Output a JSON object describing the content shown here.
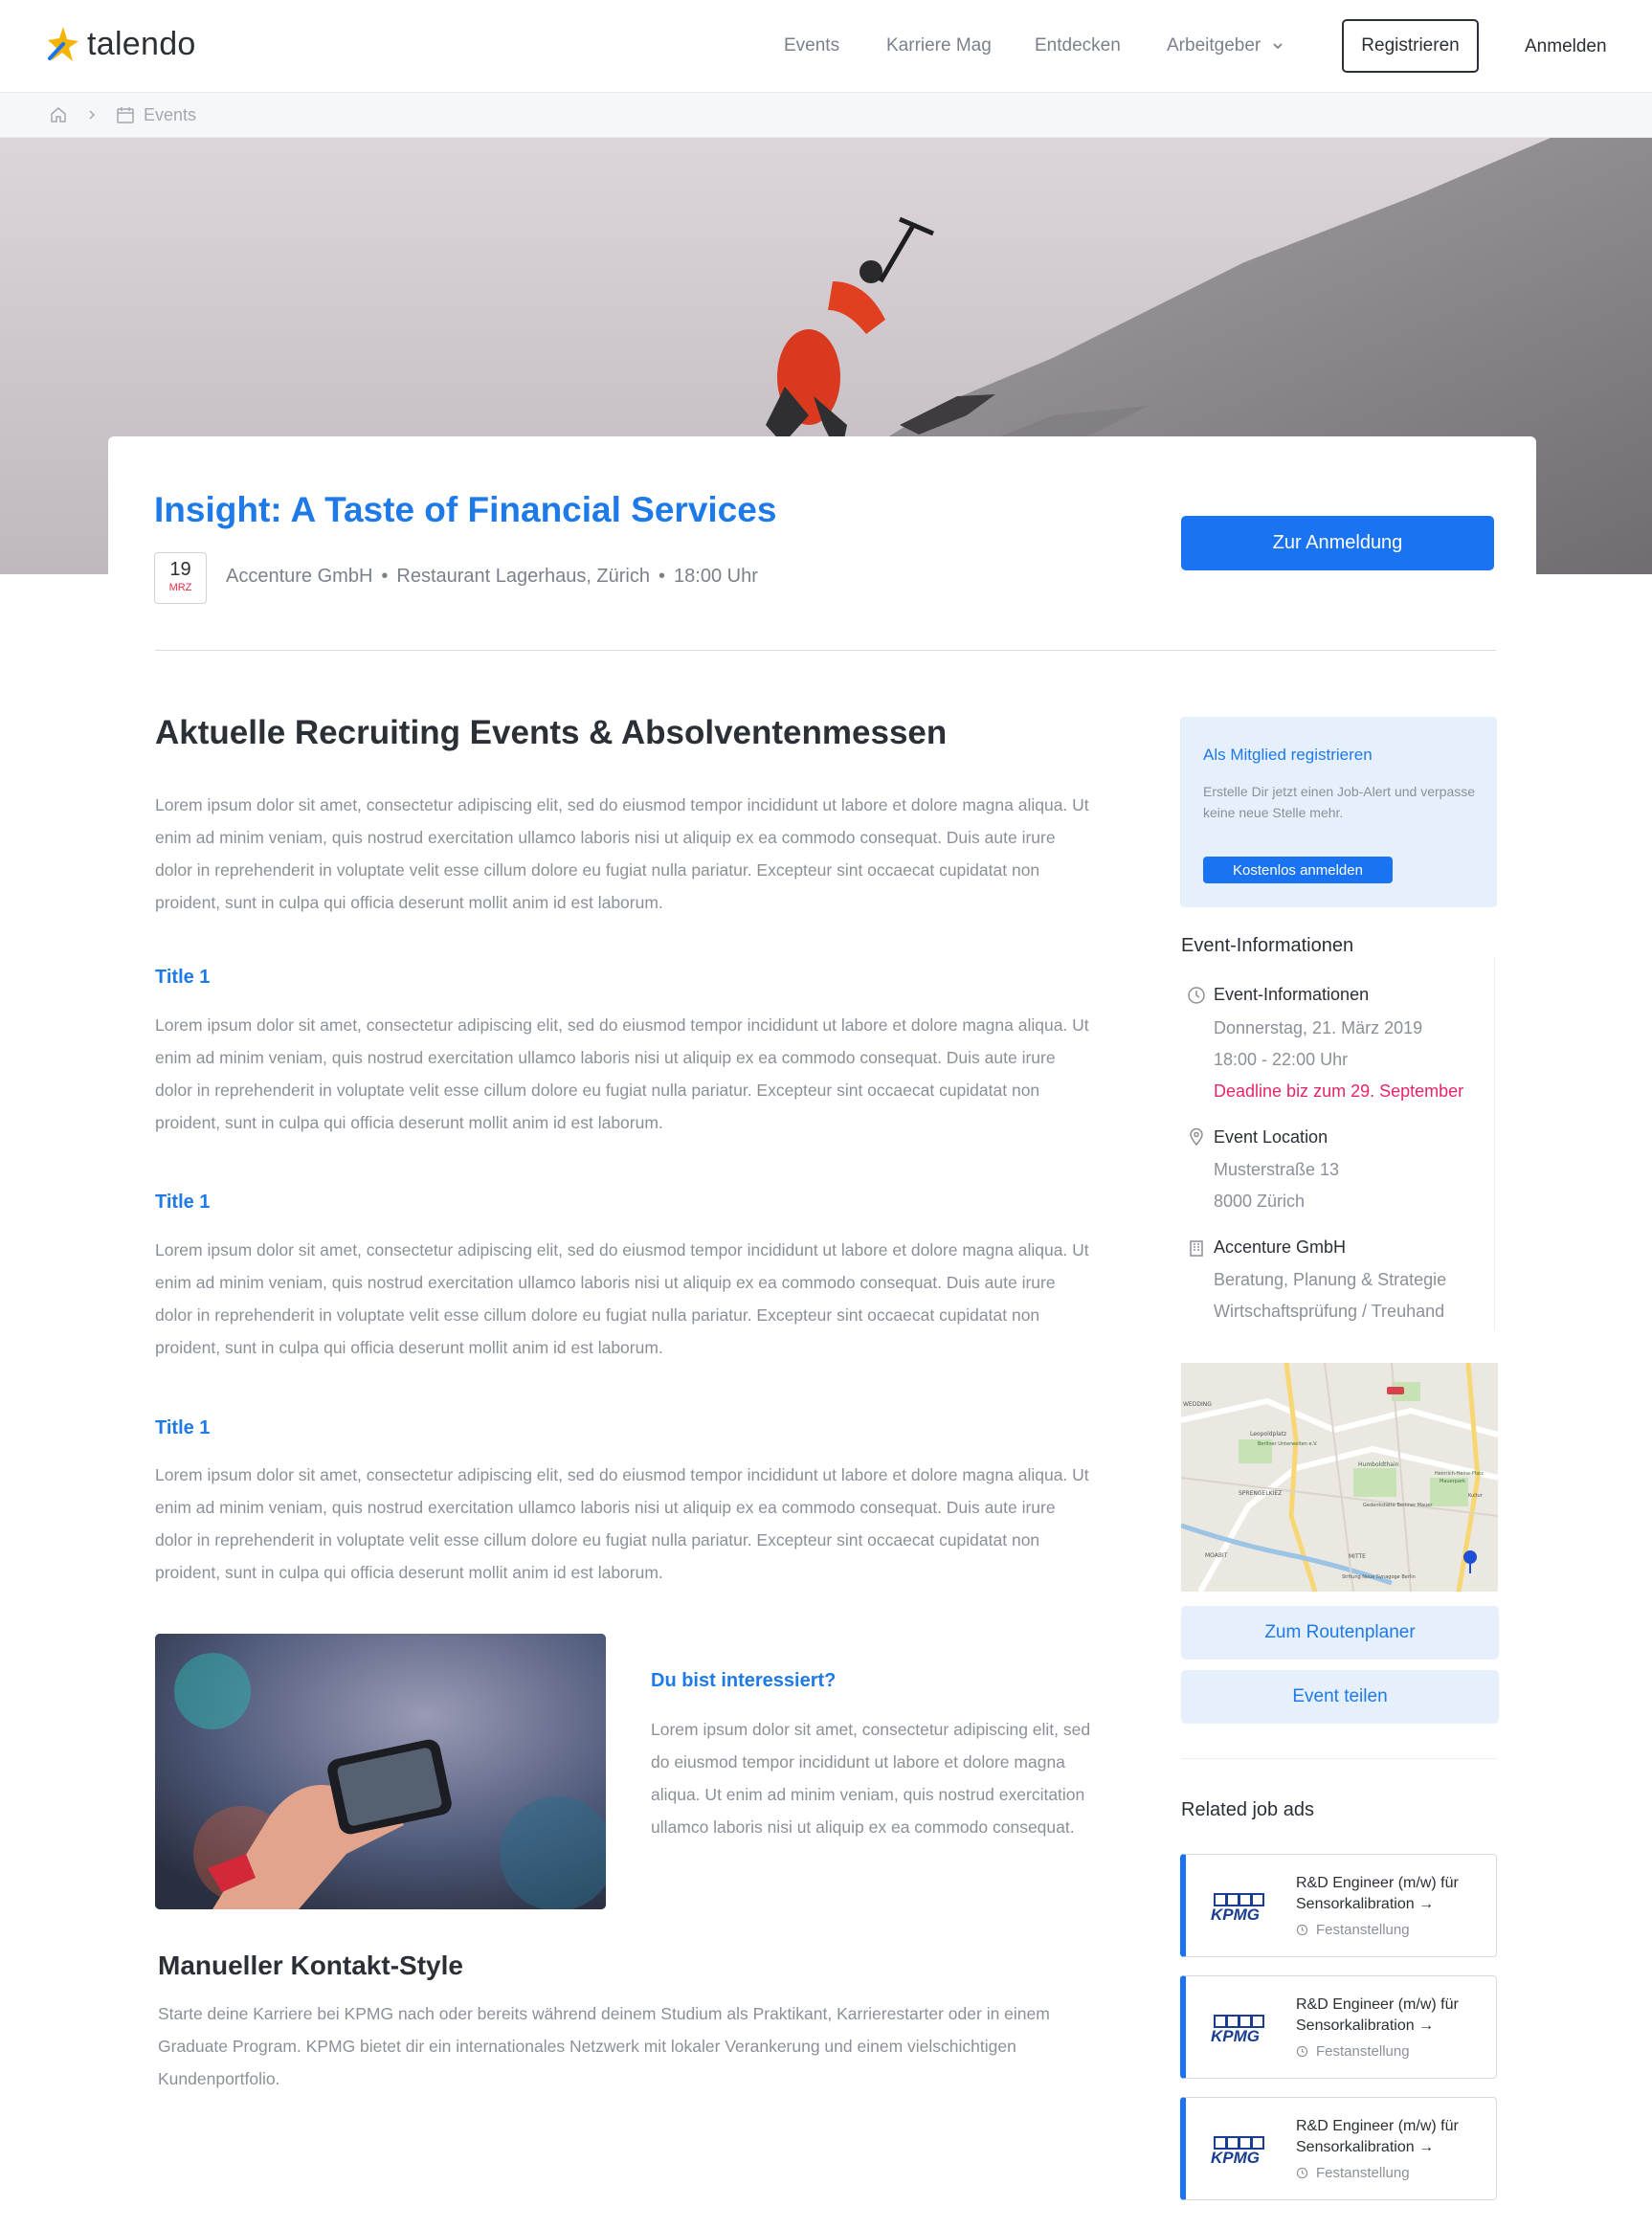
{
  "header": {
    "brand": "talendo",
    "nav": [
      "Events",
      "Karriere Mag",
      "Entdecken",
      "Arbeitgeber"
    ],
    "register_label": "Registrieren",
    "login_label": "Anmelden"
  },
  "breadcrumb": {
    "current": "Events"
  },
  "event": {
    "title": "Insight: A Taste of Financial Services",
    "day": "19",
    "month": "MRZ",
    "company": "Accenture GmbH",
    "location": "Restaurant Lagerhaus, Zürich",
    "time": "18:00 Uhr",
    "cta_label": "Zur Anmeldung"
  },
  "main": {
    "heading": "Aktuelle Recruiting Events & Absolventenmessen",
    "intro": "Lorem ipsum dolor sit amet, consectetur adipiscing elit, sed do eiusmod tempor incididunt ut labore et dolore magna aliqua. Ut enim ad minim veniam, quis nostrud exercitation ullamco laboris nisi ut aliquip ex ea commodo consequat. Duis aute irure dolor in reprehenderit in voluptate velit esse cillum dolore eu fugiat nulla pariatur. Excepteur sint occaecat cupidatat non proident, sunt in culpa qui officia deserunt mollit anim id est laborum.",
    "sections": [
      {
        "title": "Title 1",
        "text": "Lorem ipsum dolor sit amet, consectetur adipiscing elit, sed do eiusmod tempor incididunt ut labore et dolore magna aliqua. Ut enim ad minim veniam, quis nostrud exercitation ullamco laboris nisi ut aliquip ex ea commodo consequat. Duis aute irure dolor in reprehenderit in voluptate velit esse cillum dolore eu fugiat nulla pariatur. Excepteur sint occaecat cupidatat non proident, sunt in culpa qui officia deserunt mollit anim id est laborum."
      },
      {
        "title": "Title 1",
        "text": "Lorem ipsum dolor sit amet, consectetur adipiscing elit, sed do eiusmod tempor incididunt ut labore et dolore magna aliqua. Ut enim ad minim veniam, quis nostrud exercitation ullamco laboris nisi ut aliquip ex ea commodo consequat. Duis aute irure dolor in reprehenderit in voluptate velit esse cillum dolore eu fugiat nulla pariatur. Excepteur sint occaecat cupidatat non proident, sunt in culpa qui officia deserunt mollit anim id est laborum."
      },
      {
        "title": "Title 1",
        "text": "Lorem ipsum dolor sit amet, consectetur adipiscing elit, sed do eiusmod tempor incididunt ut labore et dolore magna aliqua. Ut enim ad minim veniam, quis nostrud exercitation ullamco laboris nisi ut aliquip ex ea commodo consequat. Duis aute irure dolor in reprehenderit in voluptate velit esse cillum dolore eu fugiat nulla pariatur. Excepteur sint occaecat cupidatat non proident, sunt in culpa qui officia deserunt mollit anim id est laborum."
      }
    ],
    "interest_title": "Du bist interessiert?",
    "interest_text": "Lorem ipsum dolor sit amet, consectetur adipiscing elit, sed do eiusmod tempor incididunt ut labore et dolore magna aliqua. Ut enim ad minim veniam, quis nostrud exercitation ullamco laboris nisi ut aliquip ex ea commodo consequat.",
    "contact_title": "Manueller Kontakt-Style",
    "contact_text": "Starte deine Karriere bei KPMG nach oder bereits während deinem Studium als Praktikant, Karrierestarter oder in einem Graduate Program. KPMG bietet dir ein internationales Netzwerk mit lokaler Verankerung und einem vielschichtigen Kundenportfolio."
  },
  "sidebar": {
    "promo_title": "Als Mitglied registrieren",
    "promo_text": "Erstelle Dir jetzt einen Job-Alert und verpasse keine neue Stelle mehr.",
    "promo_button": "Kostenlos anmelden",
    "info_heading": "Event-Informationen",
    "info_time_label": "Event-Informationen",
    "info_date": "Donnerstag, 21. März 2019",
    "info_hours": "18:00  - 22:00 Uhr",
    "info_deadline": "Deadline biz zum 29. September",
    "info_location_label": "Event Location",
    "info_street": "Musterstraße 13",
    "info_city": "8000 Zürich",
    "info_company_label": "Accenture GmbH",
    "info_industry_1": "Beratung, Planung & Strategie",
    "info_industry_2": "Wirtschaftsprüfung / Treuhand",
    "map_labels": [
      "WEDDING",
      "Leopoldplatz",
      "Berliner Unterwelten e.V.",
      "Humboldthain",
      "Heinrich-Heine-Platz",
      "Mauerpark",
      "SPRENGELKIEZ",
      "Gedenkstätte Berliner Mauer",
      "MOABIT",
      "MITTE",
      "Stiftung Neue Synagoge Berlin",
      "Kultur"
    ],
    "route_button": "Zum Routenplaner",
    "share_button": "Event teilen",
    "related_title": "Related job ads",
    "jobs": [
      {
        "logo": "KPMG",
        "title": "R&D Engineer (m/w) für Sensorkalibration →",
        "type": "Festanstellung"
      },
      {
        "logo": "KPMG",
        "title": "R&D Engineer (m/w) für Sensorkalibration →",
        "type": "Festanstellung"
      },
      {
        "logo": "KPMG",
        "title": "R&D Engineer (m/w) für Sensorkalibration →",
        "type": "Festanstellung"
      }
    ]
  },
  "colors": {
    "accent": "#1a73f3",
    "link": "#1d7ae8",
    "deadline": "#e5256a",
    "date_month": "#e52b4b",
    "promo_bg": "#e6f0fc"
  },
  "icons": [
    "star-logo-icon",
    "chevron-down-icon",
    "home-icon",
    "chevron-right-icon",
    "calendar-icon",
    "clock-icon",
    "location-pin-icon",
    "building-icon"
  ]
}
